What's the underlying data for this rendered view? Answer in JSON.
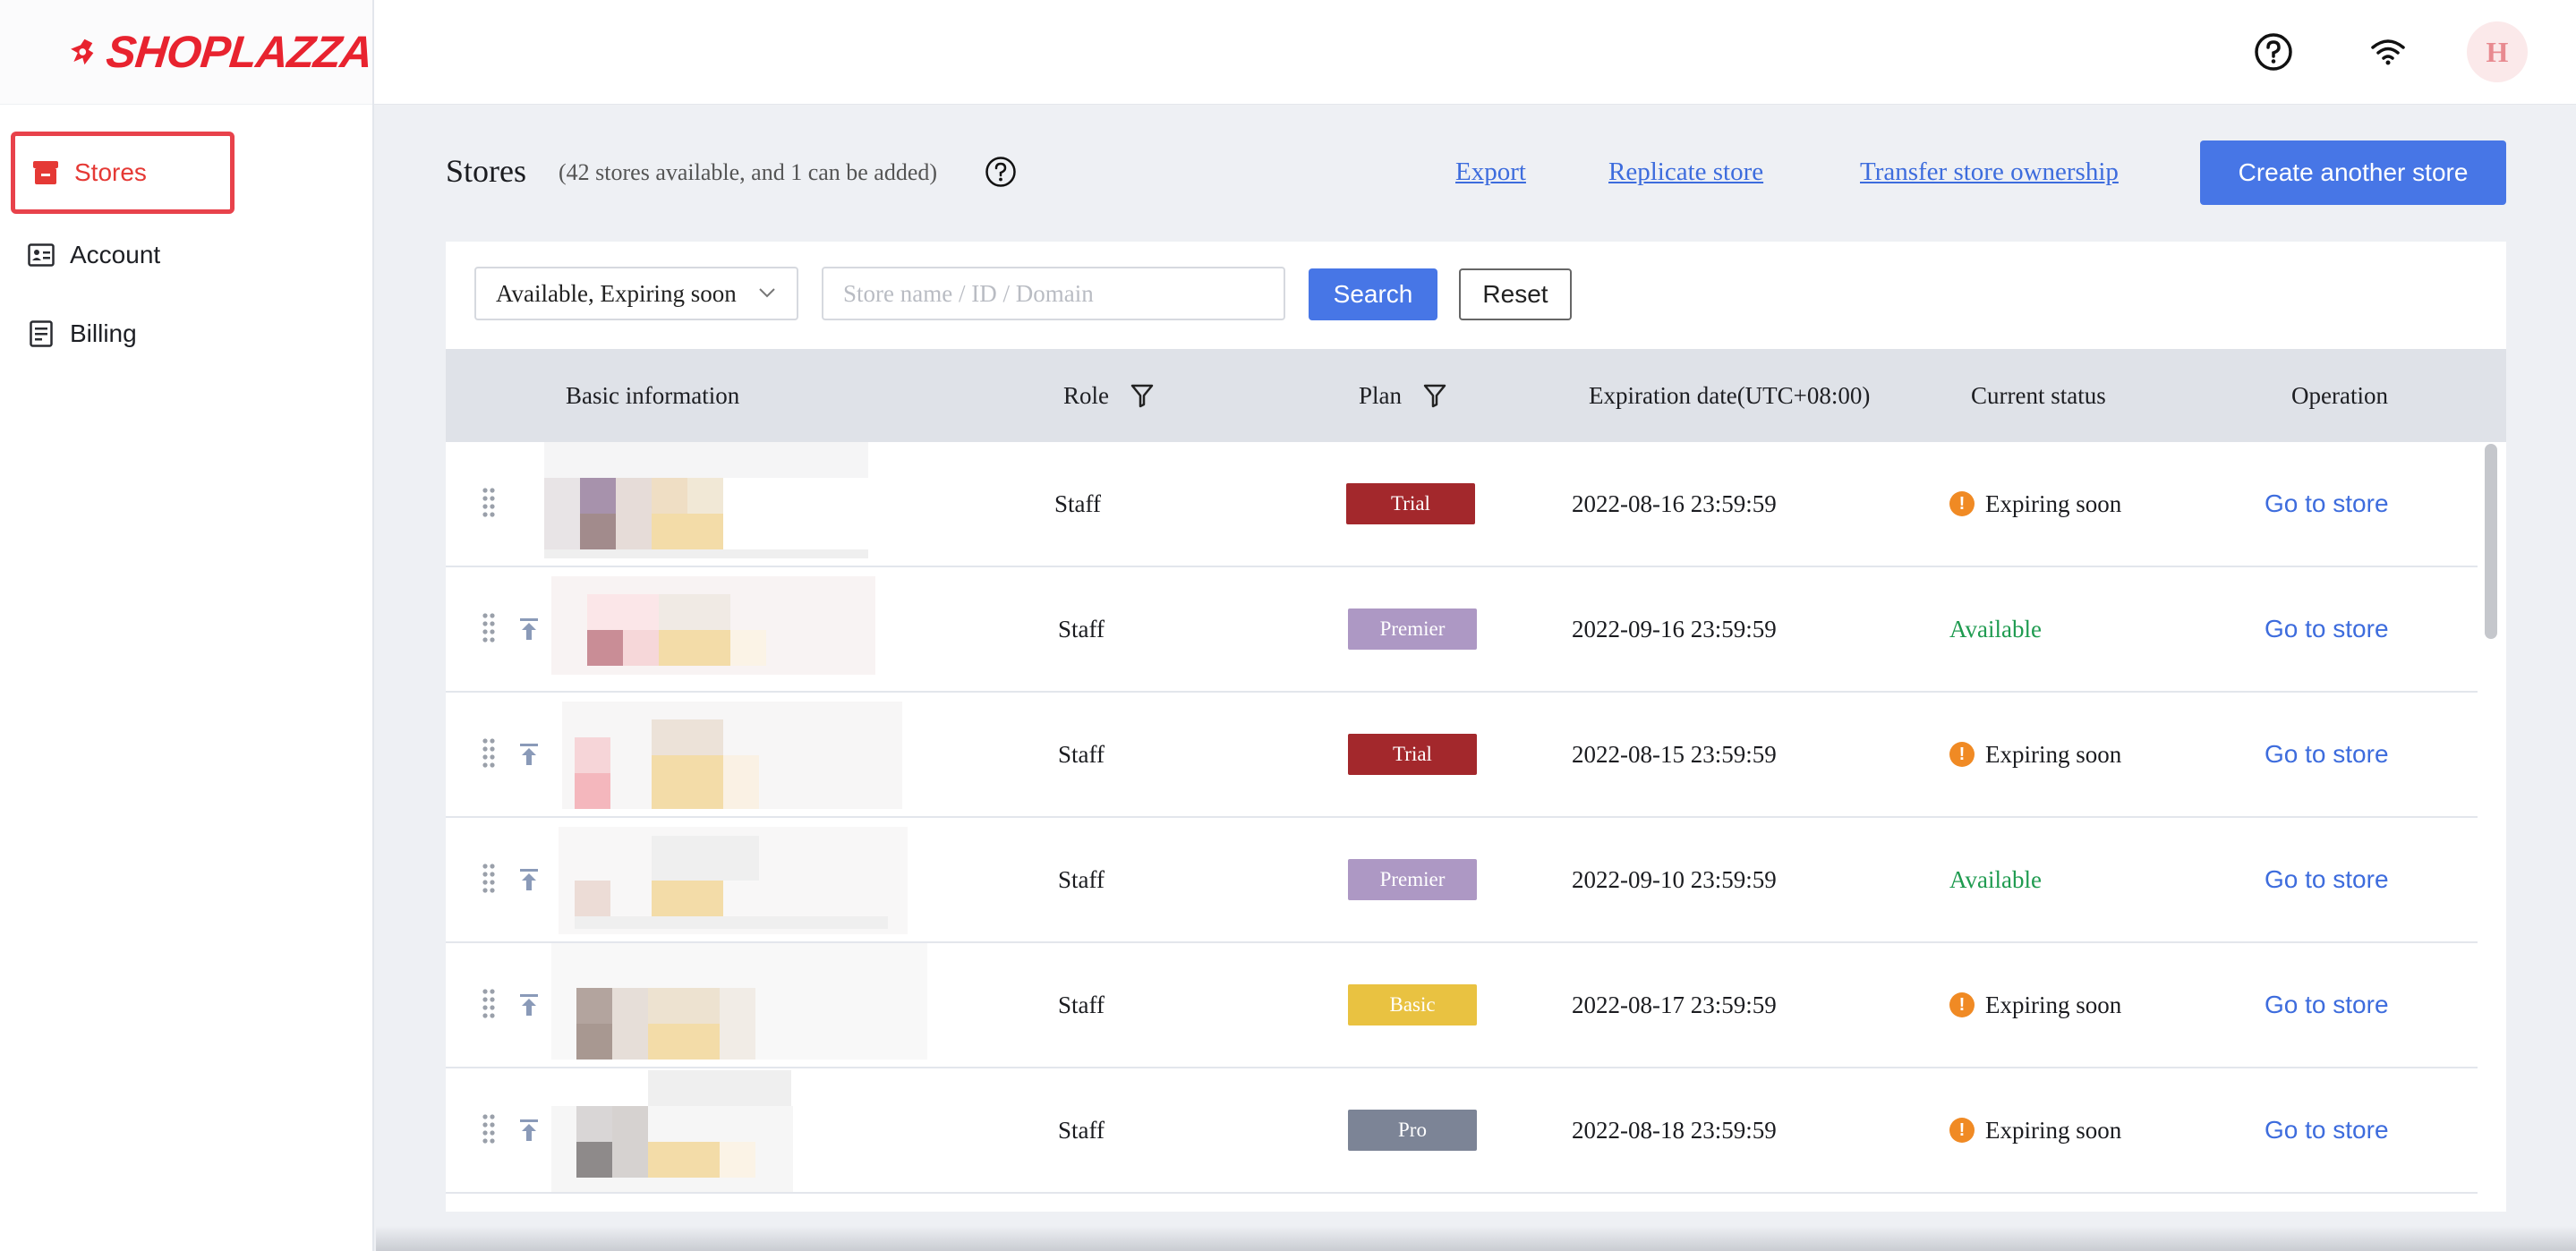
{
  "brand": {
    "name": "SHOPLAZZA",
    "color": "#e8232f"
  },
  "sidebar": {
    "items": [
      {
        "label": "Stores",
        "icon": "store-icon",
        "active": true
      },
      {
        "label": "Account",
        "icon": "id-card-icon",
        "active": false
      },
      {
        "label": "Billing",
        "icon": "bill-icon",
        "active": false
      }
    ]
  },
  "topbar": {
    "avatar_initial": "H",
    "icons": [
      "help-icon",
      "wifi-icon"
    ]
  },
  "header": {
    "title": "Stores",
    "subtitle": "(42 stores available, and 1 can be added)",
    "links": {
      "export": "Export",
      "replicate": "Replicate store",
      "transfer": "Transfer store ownership"
    },
    "create_button": "Create another store"
  },
  "filters": {
    "status_select": "Available, Expiring soon",
    "search_placeholder": "Store name / ID / Domain",
    "search_button": "Search",
    "reset_button": "Reset"
  },
  "table": {
    "columns": [
      "Basic information",
      "Role",
      "Plan",
      "Expiration date(UTC+08:00)",
      "Current status",
      "Operation"
    ],
    "rows": [
      {
        "role": "Staff",
        "plan": "Trial",
        "plan_color": "#a3282c",
        "expiration": "2022-08-16 23:59:59",
        "status": "Expiring soon",
        "operation": "Go to store"
      },
      {
        "role": "Staff",
        "plan": "Premier",
        "plan_color": "#ad98c4",
        "expiration": "2022-09-16 23:59:59",
        "status": "Available",
        "operation": "Go to store"
      },
      {
        "role": "Staff",
        "plan": "Trial",
        "plan_color": "#a3282c",
        "expiration": "2022-08-15 23:59:59",
        "status": "Expiring soon",
        "operation": "Go to store"
      },
      {
        "role": "Staff",
        "plan": "Premier",
        "plan_color": "#ad98c4",
        "expiration": "2022-09-10 23:59:59",
        "status": "Available",
        "operation": "Go to store"
      },
      {
        "role": "Staff",
        "plan": "Basic",
        "plan_color": "#e9c241",
        "expiration": "2022-08-17 23:59:59",
        "status": "Expiring soon",
        "operation": "Go to store"
      },
      {
        "role": "Staff",
        "plan": "Pro",
        "plan_color": "#7c8496",
        "expiration": "2022-08-18 23:59:59",
        "status": "Expiring soon",
        "operation": "Go to store"
      }
    ]
  },
  "colors": {
    "accent": "#4776e6",
    "link": "#3d6cdd",
    "warning": "#f08a24",
    "available": "#1f9b50"
  }
}
